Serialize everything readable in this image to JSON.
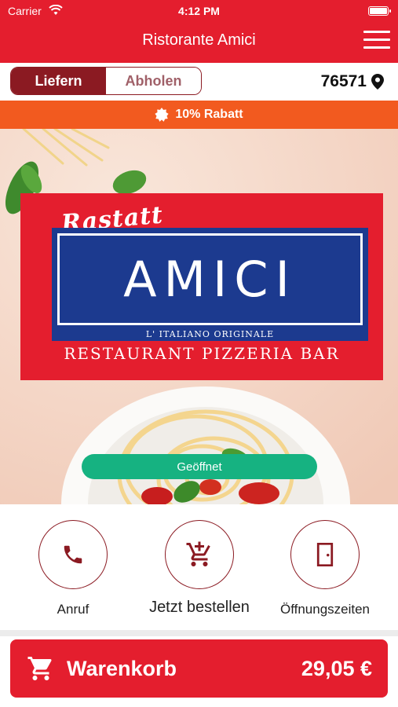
{
  "status_bar": {
    "carrier": "Carrier",
    "time": "4:12 PM"
  },
  "header": {
    "title": "Ristorante Amici",
    "menu_icon": "hamburger-menu-icon"
  },
  "order_mode": {
    "options": [
      {
        "label": "Liefern",
        "selected": true
      },
      {
        "label": "Abholen",
        "selected": false
      }
    ],
    "postcode": "76571",
    "postcode_icon": "map-pin-icon"
  },
  "discount_bar": {
    "icon": "discount-badge-icon",
    "text": "10% Rabatt"
  },
  "hero": {
    "logo": {
      "script": "Rastatt",
      "name": "AMICI",
      "subtitle": "L' ITALIANO ORIGINALE",
      "tagline": "RESTAURANT   PIZZERIA   BAR"
    },
    "status_pill": "Geöffnet"
  },
  "actions": [
    {
      "label": "Anruf",
      "icon": "phone-icon"
    },
    {
      "label": "Jetzt bestellen",
      "icon": "shopping-cart-icon"
    },
    {
      "label": "Öffnungszeiten",
      "icon": "door-icon"
    }
  ],
  "cart": {
    "label": "Warenkorb",
    "total": "29,05 €",
    "icon": "shopping-cart-icon"
  },
  "colors": {
    "brand_red": "#e41e2e",
    "dark_red": "#8b1a22",
    "discount_orange": "#f25a1f",
    "open_green": "#16b281",
    "logo_blue": "#1c3a8f"
  }
}
